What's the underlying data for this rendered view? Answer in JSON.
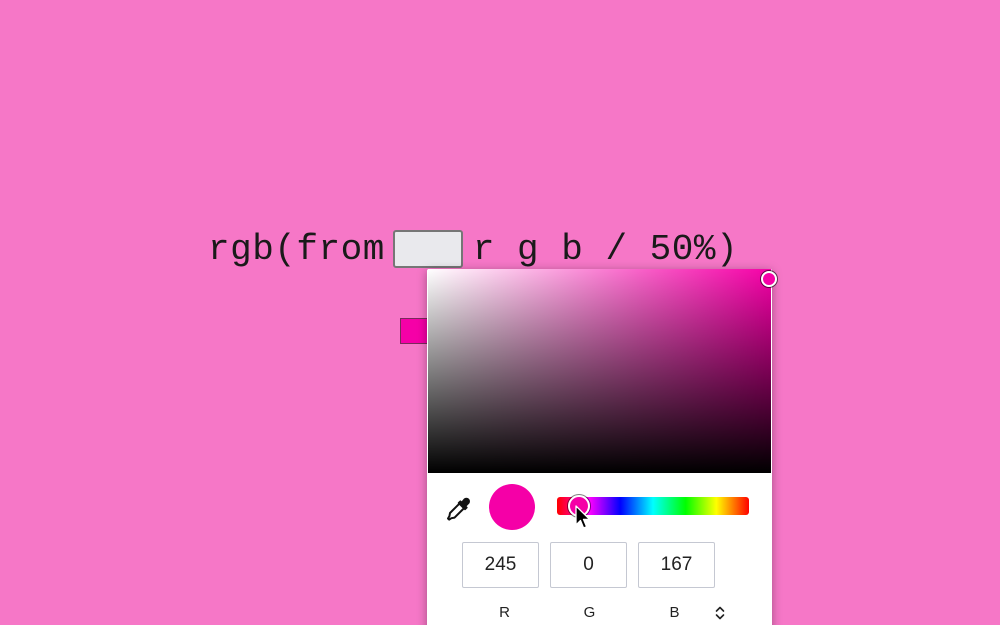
{
  "colors": {
    "page_background": "#f677c7",
    "selected_color": "#f500a7"
  },
  "expression": {
    "prefix": "rgb(from",
    "suffix": "r g b / 50%)"
  },
  "color_picker": {
    "eyedropper_icon": "eyedropper-icon",
    "channels": [
      {
        "value": "245",
        "label": "R"
      },
      {
        "value": "0",
        "label": "G"
      },
      {
        "value": "167",
        "label": "B"
      }
    ],
    "mode_toggle_icon": "up-down-chevron-icon"
  }
}
